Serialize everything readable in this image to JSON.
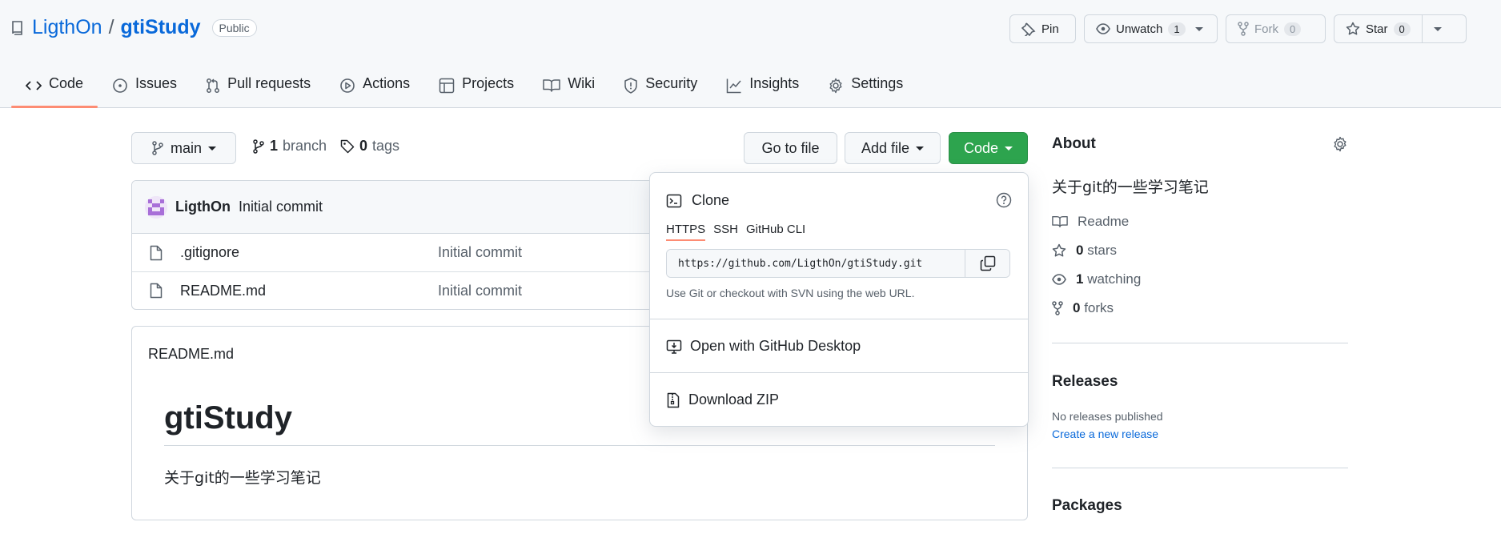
{
  "repo": {
    "owner": "LigthOn",
    "separator": "/",
    "name": "gtiStudy",
    "visibility": "Public"
  },
  "actions": {
    "pin": "Pin",
    "unwatch": "Unwatch",
    "unwatch_count": "1",
    "fork": "Fork",
    "fork_count": "0",
    "star": "Star",
    "star_count": "0"
  },
  "tabs": [
    {
      "label": "Code",
      "icon": "code-icon",
      "active": true
    },
    {
      "label": "Issues",
      "icon": "issue-icon"
    },
    {
      "label": "Pull requests",
      "icon": "pull-request-icon"
    },
    {
      "label": "Actions",
      "icon": "play-icon"
    },
    {
      "label": "Projects",
      "icon": "table-icon"
    },
    {
      "label": "Wiki",
      "icon": "book-icon"
    },
    {
      "label": "Security",
      "icon": "shield-icon"
    },
    {
      "label": "Insights",
      "icon": "graph-icon"
    },
    {
      "label": "Settings",
      "icon": "gear-icon"
    }
  ],
  "toolbar": {
    "branch": "main",
    "branch_count": "1",
    "branch_label": "branch",
    "tag_count": "0",
    "tag_label": "tags",
    "go_to_file": "Go to file",
    "add_file": "Add file",
    "code": "Code"
  },
  "commit": {
    "author": "LigthOn",
    "message": "Initial commit"
  },
  "files": [
    {
      "name": ".gitignore",
      "message": "Initial commit"
    },
    {
      "name": "README.md",
      "message": "Initial commit"
    }
  ],
  "readme": {
    "header": "README.md",
    "title": "gtiStudy",
    "description": "关于git的一些学习笔记"
  },
  "clone": {
    "title": "Clone",
    "protocols": [
      "HTTPS",
      "SSH",
      "GitHub CLI"
    ],
    "active_protocol": "HTTPS",
    "url": "https://github.com/LigthOn/gtiStudy.git",
    "hint": "Use Git or checkout with SVN using the web URL.",
    "open_desktop": "Open with GitHub Desktop",
    "download_zip": "Download ZIP"
  },
  "about": {
    "heading": "About",
    "description": "关于git的一些学习笔记",
    "readme": "Readme",
    "stars_count": "0",
    "stars_label": "stars",
    "watching_count": "1",
    "watching_label": "watching",
    "forks_count": "0",
    "forks_label": "forks"
  },
  "releases": {
    "heading": "Releases",
    "none": "No releases published",
    "create": "Create a new release"
  },
  "packages": {
    "heading": "Packages"
  },
  "colors": {
    "link": "#0969da",
    "primary_button": "#2da44e",
    "tab_underline": "#fd8c73"
  }
}
